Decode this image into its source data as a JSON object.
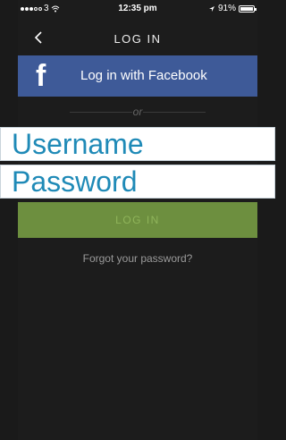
{
  "status_bar": {
    "carrier": "3",
    "time": "12:35 pm",
    "battery": "91%"
  },
  "nav": {
    "title": "LOG IN"
  },
  "facebook": {
    "label": "Log in with Facebook",
    "icon": "facebook-icon",
    "color": "#3e5a98"
  },
  "divider": {
    "text": "or"
  },
  "form": {
    "username_placeholder": "Username",
    "password_placeholder": "Password",
    "submit_label": "LOG IN",
    "forgot_label": "Forgot your password?",
    "accent_color": "#1f8ab7",
    "button_color": "#6d8f3f"
  }
}
